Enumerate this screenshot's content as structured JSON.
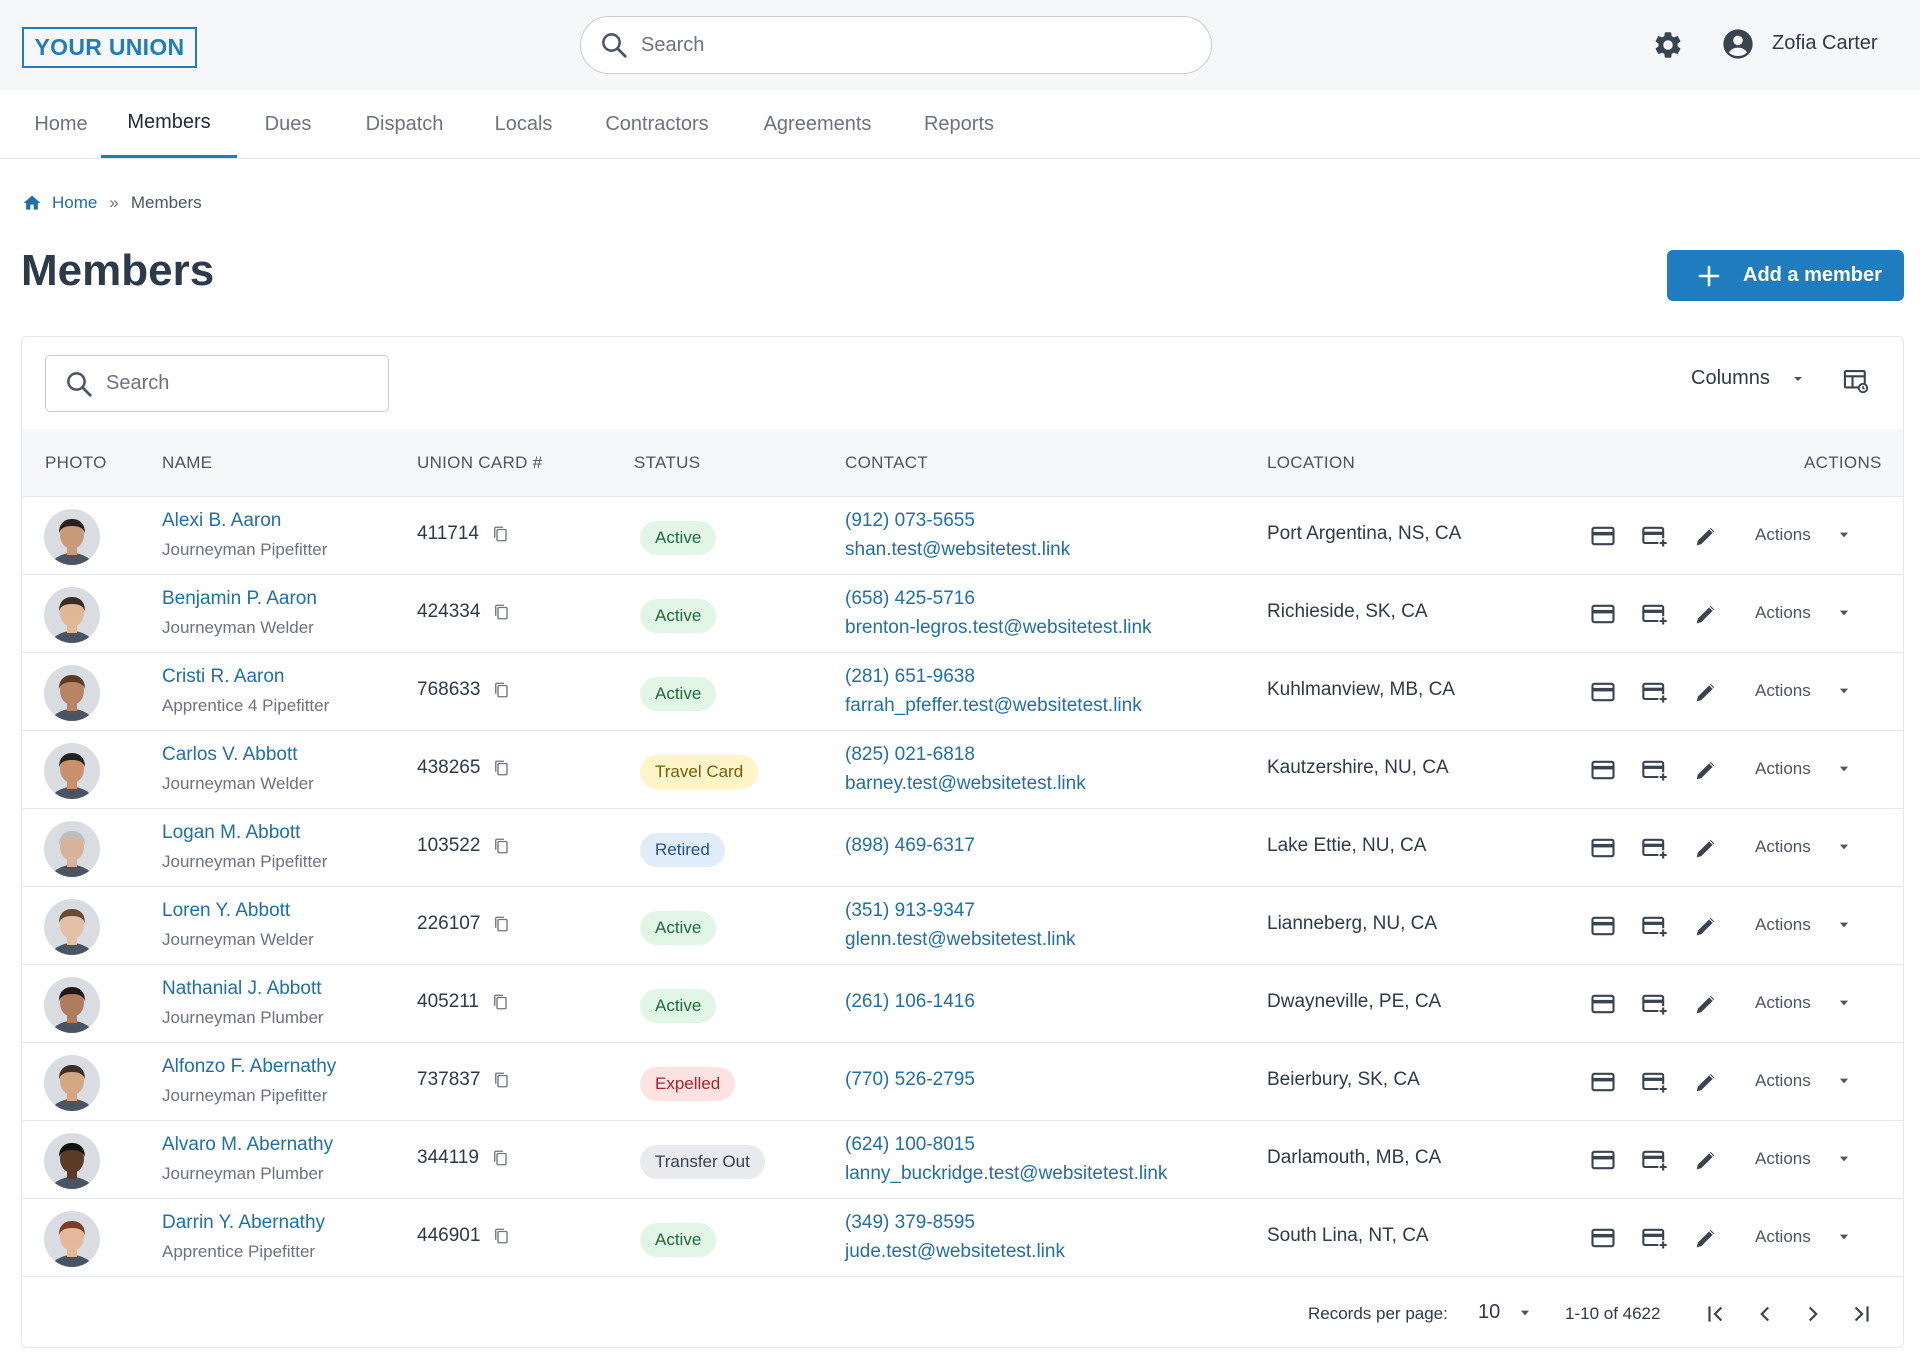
{
  "header": {
    "logo": "YOUR UNION",
    "search_placeholder": "Search",
    "settings_icon": "gear-icon",
    "user_icon": "account-circle-icon",
    "user_name": "Zofia Carter"
  },
  "nav": {
    "items": [
      "Home",
      "Members",
      "Dues",
      "Dispatch",
      "Locals",
      "Contractors",
      "Agreements",
      "Reports"
    ],
    "active": "Members"
  },
  "breadcrumb": {
    "home": "Home",
    "separator": "»",
    "current": "Members"
  },
  "page": {
    "title": "Members",
    "add_button": "Add a member"
  },
  "table": {
    "search_placeholder": "Search",
    "columns_label": "Columns",
    "headers": {
      "photo": "PHOTO",
      "name": "NAME",
      "card": "UNION CARD #",
      "status": "STATUS",
      "contact": "CONTACT",
      "location": "LOCATION",
      "actions": "ACTIONS"
    },
    "row_action_label": "Actions",
    "rows": [
      {
        "name": "Alexi B. Aaron",
        "trade": "Journeyman Pipefitter",
        "card": "411714",
        "status": "Active",
        "status_kind": "active",
        "phone": "(912) 073-5655",
        "email": "shan.test@websitetest.link",
        "location": "Port Argentina, NS, CA"
      },
      {
        "name": "Benjamin P. Aaron",
        "trade": "Journeyman Welder",
        "card": "424334",
        "status": "Active",
        "status_kind": "active",
        "phone": "(658) 425-5716",
        "email": "brenton-legros.test@websitetest.link",
        "location": "Richieside, SK, CA"
      },
      {
        "name": "Cristi R. Aaron",
        "trade": "Apprentice 4 Pipefitter",
        "card": "768633",
        "status": "Active",
        "status_kind": "active",
        "phone": "(281) 651-9638",
        "email": "farrah_pfeffer.test@websitetest.link",
        "location": "Kuhlmanview, MB, CA"
      },
      {
        "name": "Carlos V. Abbott",
        "trade": "Journeyman Welder",
        "card": "438265",
        "status": "Travel Card",
        "status_kind": "travel",
        "phone": "(825) 021-6818",
        "email": "barney.test@websitetest.link",
        "location": "Kautzershire, NU, CA"
      },
      {
        "name": "Logan M. Abbott",
        "trade": "Journeyman Pipefitter",
        "card": "103522",
        "status": "Retired",
        "status_kind": "retired",
        "phone": "(898) 469-6317",
        "email": "",
        "location": "Lake Ettie, NU, CA"
      },
      {
        "name": "Loren Y. Abbott",
        "trade": "Journeyman Welder",
        "card": "226107",
        "status": "Active",
        "status_kind": "active",
        "phone": "(351) 913-9347",
        "email": "glenn.test@websitetest.link",
        "location": "Lianneberg, NU, CA"
      },
      {
        "name": "Nathanial J. Abbott",
        "trade": "Journeyman Plumber",
        "card": "405211",
        "status": "Active",
        "status_kind": "active",
        "phone": "(261) 106-1416",
        "email": "",
        "location": "Dwayneville, PE, CA"
      },
      {
        "name": "Alfonzo F. Abernathy",
        "trade": "Journeyman Pipefitter",
        "card": "737837",
        "status": "Expelled",
        "status_kind": "expelled",
        "phone": "(770) 526-2795",
        "email": "",
        "location": "Beierbury, SK, CA"
      },
      {
        "name": "Alvaro M. Abernathy",
        "trade": "Journeyman Plumber",
        "card": "344119",
        "status": "Transfer Out",
        "status_kind": "transfer",
        "phone": "(624) 100-8015",
        "email": "lanny_buckridge.test@websitetest.link",
        "location": "Darlamouth, MB, CA"
      },
      {
        "name": "Darrin Y. Abernathy",
        "trade": "Apprentice Pipefitter",
        "card": "446901",
        "status": "Active",
        "status_kind": "active",
        "phone": "(349) 379-8595",
        "email": "jude.test@websitetest.link",
        "location": "South Lina, NT, CA"
      }
    ]
  },
  "pagination": {
    "records_label": "Records per page:",
    "per_page": "10",
    "range": "1-10 of 4622"
  },
  "colors": {
    "primary": "#1f7dbf",
    "link": "#1f6fa8",
    "text": "#2d3a4a",
    "muted": "#6b7280",
    "header_bg": "#f6f7f9"
  }
}
